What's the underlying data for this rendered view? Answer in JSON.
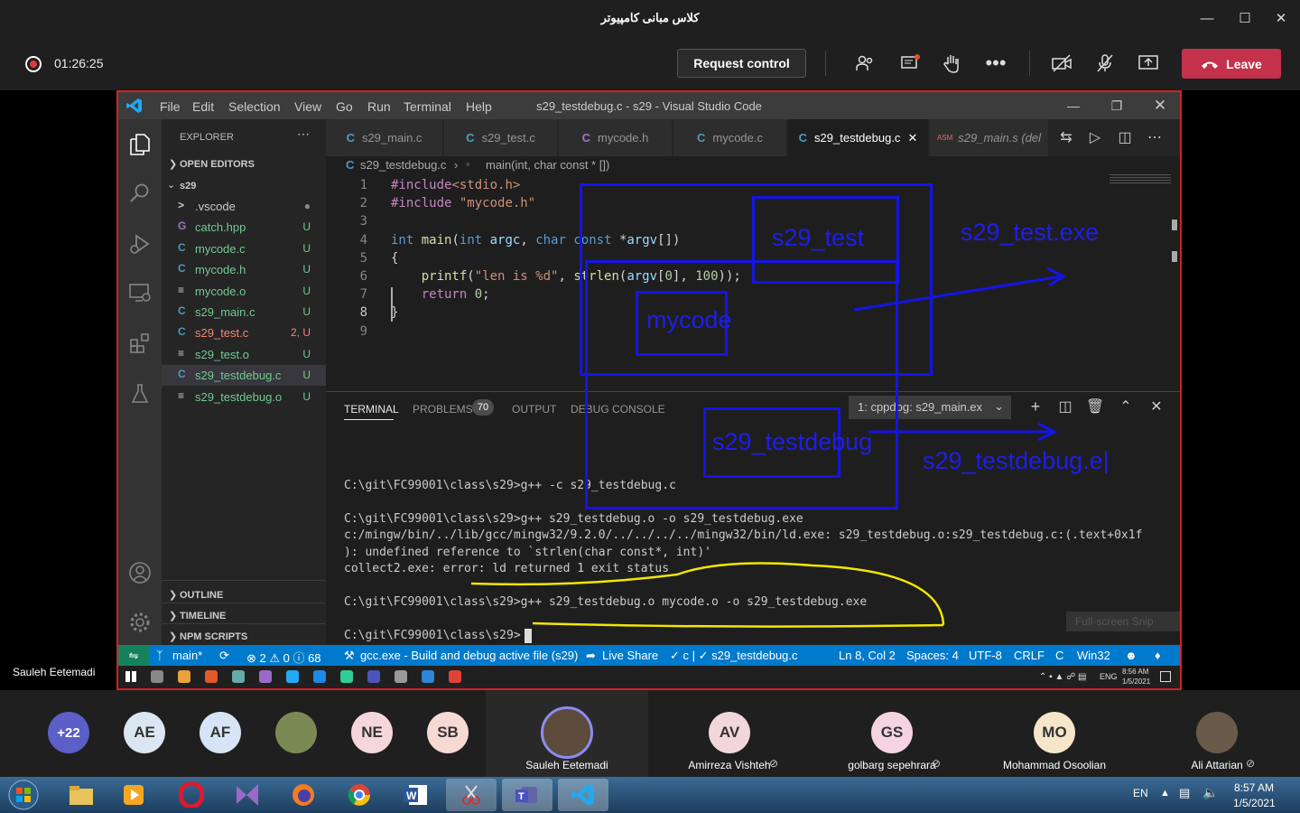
{
  "teams": {
    "title": "کلاس مبانی کامپیوتر",
    "timer": "01:26:25",
    "request_control": "Request control",
    "leave": "Leave",
    "presenter_label": "Sauleh Eetemadi"
  },
  "vscode": {
    "menu": [
      "File",
      "Edit",
      "Selection",
      "View",
      "Go",
      "Run",
      "Terminal",
      "Help"
    ],
    "title": "s29_testdebug.c - s29 - Visual Studio Code",
    "explorer": {
      "header": "EXPLORER",
      "open_editors": "OPEN EDITORS",
      "folder": "s29",
      "files": [
        {
          "icon": ">",
          "name": ".vscode",
          "badge": "●",
          "color": "#cccccc"
        },
        {
          "icon": "G",
          "name": "catch.hpp",
          "badge": "U",
          "color": "#73c991"
        },
        {
          "icon": "C",
          "name": "mycode.c",
          "badge": "U",
          "color": "#73c991"
        },
        {
          "icon": "C",
          "name": "mycode.h",
          "badge": "U",
          "color": "#73c991"
        },
        {
          "icon": "≡",
          "name": "mycode.o",
          "badge": "U",
          "color": "#73c991"
        },
        {
          "icon": "C",
          "name": "s29_main.c",
          "badge": "U",
          "color": "#73c991"
        },
        {
          "icon": "C",
          "name": "s29_test.c",
          "badge": "2, U",
          "color": "#f48771"
        },
        {
          "icon": "≡",
          "name": "s29_test.o",
          "badge": "U",
          "color": "#73c991"
        },
        {
          "icon": "C",
          "name": "s29_testdebug.c",
          "badge": "U",
          "color": "#73c991"
        },
        {
          "icon": "≡",
          "name": "s29_testdebug.o",
          "badge": "U",
          "color": "#73c991"
        }
      ],
      "outline": "OUTLINE",
      "timeline": "TIMELINE",
      "npm": "NPM SCRIPTS"
    },
    "tabs": [
      "s29_main.c",
      "s29_test.c",
      "mycode.h",
      "mycode.c",
      "s29_testdebug.c",
      "s29_main.s (del"
    ],
    "breadcrumb": {
      "file": "s29_testdebug.c",
      "symbol": "main(int, char const * [])"
    },
    "line_numbers": [
      "1",
      "2",
      "3",
      "4",
      "5",
      "6",
      "7",
      "8",
      "9"
    ],
    "panel_tabs": {
      "terminal": "TERMINAL",
      "problems": "PROBLEMS",
      "problems_count": "70",
      "output": "OUTPUT",
      "debug": "DEBUG CONSOLE"
    },
    "terminal_select": "1: cppdbg: s29_main.ex",
    "terminal_lines": [
      "C:\\git\\FC99001\\class\\s29>g++ -c s29_testdebug.c",
      "",
      "C:\\git\\FC99001\\class\\s29>g++ s29_testdebug.o -o s29_testdebug.exe",
      "c:/mingw/bin/../lib/gcc/mingw32/9.2.0/../../../../mingw32/bin/ld.exe: s29_testdebug.o:s29_testdebug.c:(.text+0x1f",
      "): undefined reference to `strlen(char const*, int)'",
      "collect2.exe: error: ld returned 1 exit status",
      "",
      "C:\\git\\FC99001\\class\\s29>g++ s29_testdebug.o mycode.o -o s29_testdebug.exe",
      "",
      "C:\\git\\FC99001\\class\\s29>"
    ],
    "status": {
      "branch": "main*",
      "problems": "⊗ 2 ⚠ 0 ⓘ 68",
      "task": "gcc.exe - Build and debug active file (s29)",
      "liveshare": "Live Share",
      "lang_check": "✓ c | ✓ s29_testdebug.c",
      "position": "Ln 8, Col 2",
      "spaces": "Spaces: 4",
      "encoding": "UTF-8",
      "eol": "CRLF",
      "lang": "C",
      "platform": "Win32"
    },
    "snip_label": "Full-screen Snip",
    "inner_tray": {
      "lang": "ENG",
      "time": "8:56 AM",
      "date": "1/5/2021"
    }
  },
  "annotations": {
    "s29_test": "s29_test",
    "s29_test_exe": "s29_test.exe",
    "mycode": "mycode",
    "s29_testdebug": "s29_testdebug",
    "s29_testdebug_exe": "s29_testdebug.e|"
  },
  "participants": {
    "overflow": "+22",
    "avatars": [
      {
        "initials": "AE",
        "bg": "#dbe6f2"
      },
      {
        "initials": "AF",
        "bg": "#d6e4f5"
      },
      {
        "initials": "",
        "bg": "#7b8a55"
      },
      {
        "initials": "NE",
        "bg": "#f6d6dd"
      },
      {
        "initials": "SB",
        "bg": "#f7d9d3"
      }
    ],
    "speakers": [
      {
        "name": "Sauleh Eetemadi",
        "initials": "",
        "bg": "#5c4a3a",
        "muted": false
      },
      {
        "name": "Amirreza Vishteh",
        "initials": "AV",
        "bg": "#f1d7dc",
        "muted": true
      },
      {
        "name": "golbarg sepehrara",
        "initials": "GS",
        "bg": "#f6d3e0",
        "muted": true
      },
      {
        "name": "Mohammad Osoolian",
        "initials": "MO",
        "bg": "#f6e6c9",
        "muted": false
      },
      {
        "name": "Ali Attarian",
        "initials": "",
        "bg": "#6a5a4a",
        "muted": true
      }
    ]
  },
  "os_taskbar": {
    "lang": "EN",
    "time": "8:57 AM",
    "date": "1/5/2021"
  }
}
